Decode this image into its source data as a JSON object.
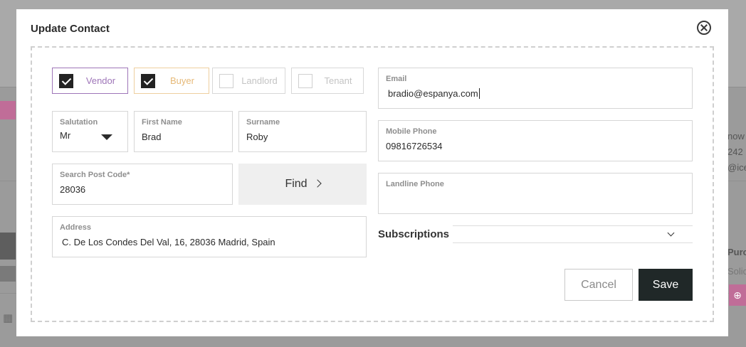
{
  "background": {
    "right_texts": [
      "now",
      "242",
      "@ice",
      "Purc",
      "Solic"
    ]
  },
  "modal": {
    "title": "Update Contact"
  },
  "roles": [
    {
      "label": "Vendor",
      "checked": true
    },
    {
      "label": "Buyer",
      "checked": true
    },
    {
      "label": "Landlord",
      "checked": false
    },
    {
      "label": "Tenant",
      "checked": false
    }
  ],
  "fields": {
    "salutation": {
      "label": "Salutation",
      "value": "Mr"
    },
    "first_name": {
      "label": "First Name",
      "value": "Brad"
    },
    "surname": {
      "label": "Surname",
      "value": "Roby"
    },
    "post_code": {
      "label": "Search Post Code*",
      "value": "28036"
    },
    "address": {
      "label": "Address",
      "value": "C. De Los Condes Del Val, 16, 28036 Madrid, Spain"
    },
    "email": {
      "label": "Email",
      "value": "bradio@espanya.com"
    },
    "mobile_phone": {
      "label": "Mobile Phone",
      "value": "09816726534"
    },
    "landline_phone": {
      "label": "Landline Phone",
      "value": ""
    }
  },
  "find_button": {
    "label": "Find"
  },
  "subscriptions": {
    "label": "Subscriptions",
    "value": ""
  },
  "actions": {
    "cancel_label": "Cancel",
    "save_label": "Save"
  },
  "colors": {
    "vendor": "#9e75b8",
    "buyer": "#e6b978",
    "save_bg": "#202828",
    "overlay": "#9b9b9b"
  }
}
